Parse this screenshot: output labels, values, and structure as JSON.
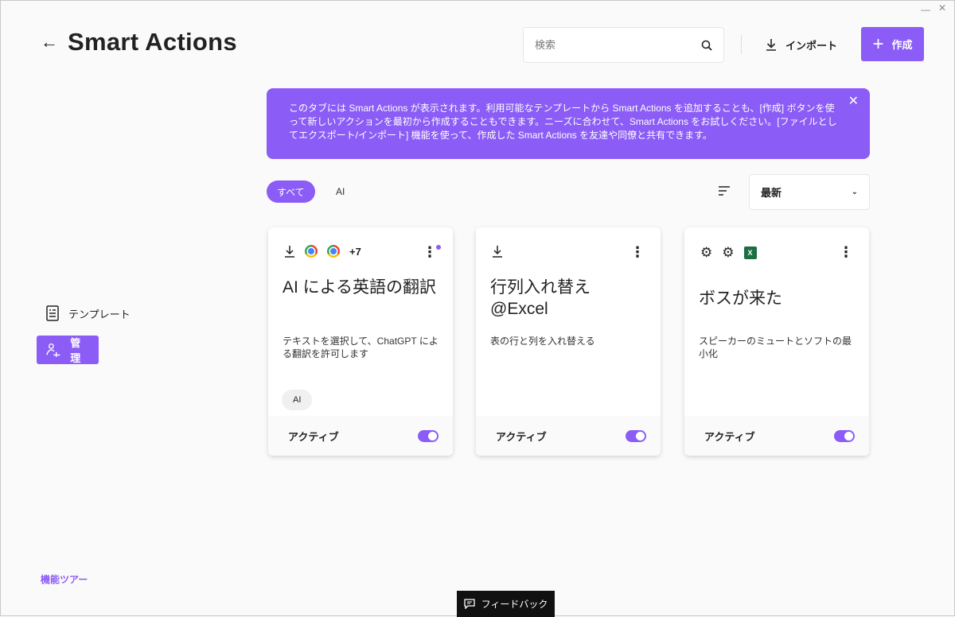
{
  "header": {
    "title": "Smart Actions",
    "search_placeholder": "検索",
    "import_label": "インポート",
    "create_label": "作成"
  },
  "banner": {
    "text": "このタブには Smart Actions が表示されます。利用可能なテンプレートから Smart Actions を追加することも、[作成] ボタンを使って新しいアクションを最初から作成することもできます。ニーズに合わせて、Smart Actions をお試しください。[ファイルとしてエクスポート/インポート] 機能を使って、作成した Smart Actions を友達や同僚と共有できます。"
  },
  "filters": {
    "all": "すべて",
    "ai": "AI",
    "sort_value": "最新"
  },
  "cards": [
    {
      "title": "AI による英語の翻訳",
      "desc": "テキストを選択して、ChatGPT による翻訳を許可します",
      "tag": "AI",
      "extra": "+7",
      "status": "アクティブ",
      "active": true
    },
    {
      "title": "行列入れ替え@Excel",
      "desc": "表の行と列を入れ替える",
      "status": "アクティブ",
      "active": true
    },
    {
      "title": "ボスが来た",
      "desc": "スピーカーのミュートとソフトの最小化",
      "status": "アクティブ",
      "active": true
    }
  ],
  "sidebar": {
    "items": [
      {
        "label": "テンプレート"
      },
      {
        "label": "管理"
      }
    ],
    "tour": "機能ツアー"
  },
  "feedback": "フィードバック",
  "colors": {
    "accent": "#8b5cf6"
  }
}
